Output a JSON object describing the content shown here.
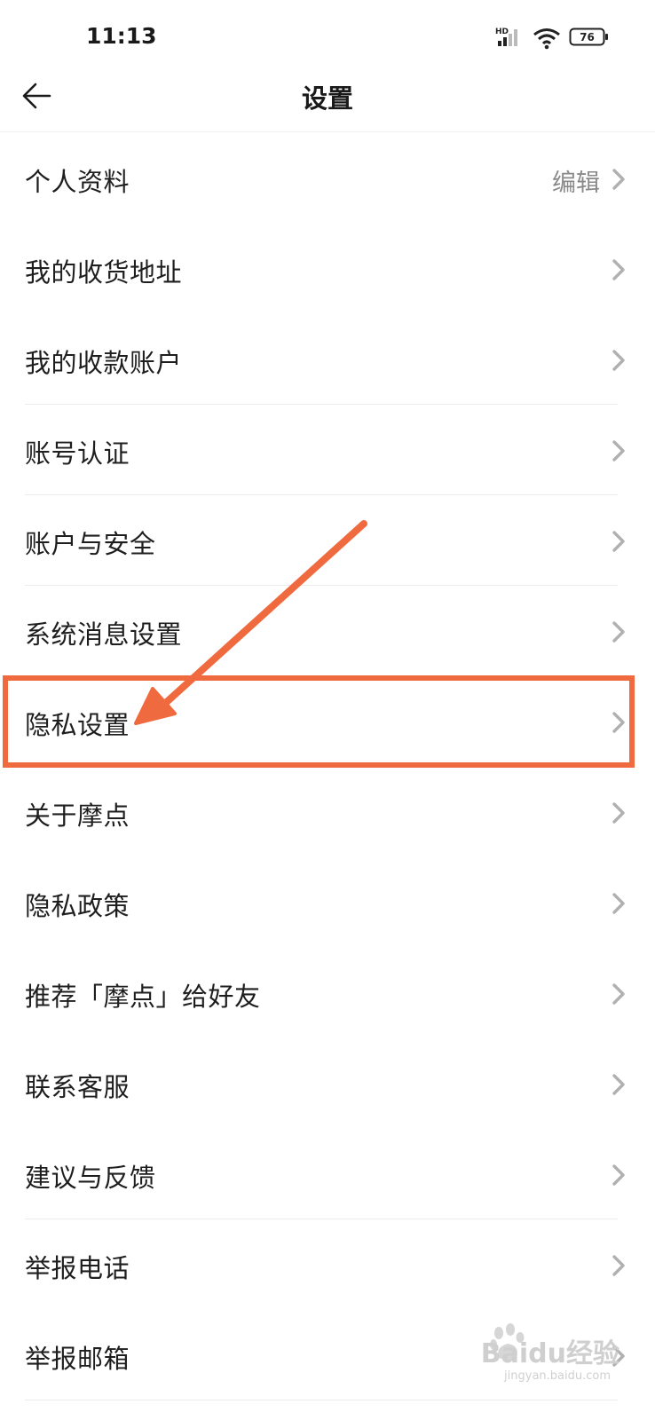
{
  "status_bar": {
    "time": "11:13",
    "network_badge": "HD",
    "battery": "76"
  },
  "header": {
    "title": "设置"
  },
  "menu": [
    {
      "label": "个人资料",
      "value": "编辑",
      "divider": false
    },
    {
      "label": "我的收货地址",
      "value": "",
      "divider": false
    },
    {
      "label": "我的收款账户",
      "value": "",
      "divider": true
    },
    {
      "label": "账号认证",
      "value": "",
      "divider": true
    },
    {
      "label": "账户与安全",
      "value": "",
      "divider": true
    },
    {
      "label": "系统消息设置",
      "value": "",
      "divider": false
    },
    {
      "label": "隐私设置",
      "value": "",
      "divider": true
    },
    {
      "label": "关于摩点",
      "value": "",
      "divider": false
    },
    {
      "label": "隐私政策",
      "value": "",
      "divider": false
    },
    {
      "label": "推荐「摩点」给好友",
      "value": "",
      "divider": false
    },
    {
      "label": "联系客服",
      "value": "",
      "divider": false
    },
    {
      "label": "建议与反馈",
      "value": "",
      "divider": true
    },
    {
      "label": "举报电话",
      "value": "",
      "divider": false
    },
    {
      "label": "举报邮箱",
      "value": "",
      "divider": true
    }
  ],
  "annotation": {
    "color": "#f06a3f",
    "highlighted_item": "隐私设置"
  },
  "watermark": {
    "brand": "Baidu经验",
    "url": "jingyan.baidu.com"
  }
}
